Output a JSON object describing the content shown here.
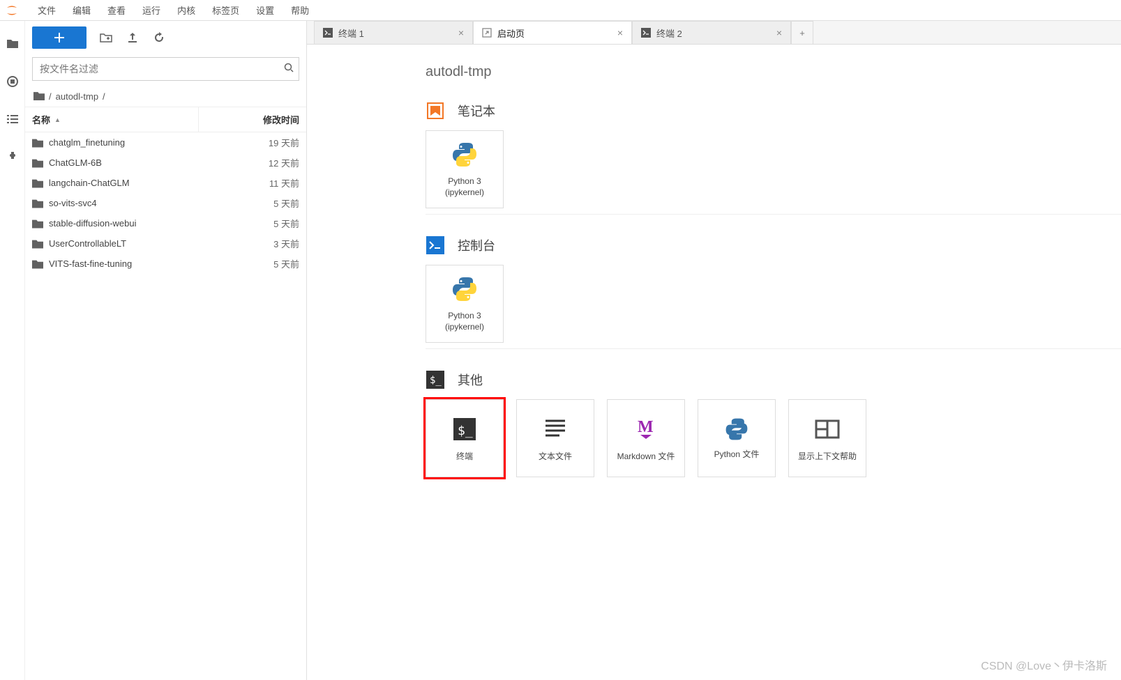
{
  "menu": {
    "items": [
      "文件",
      "编辑",
      "查看",
      "运行",
      "内核",
      "标签页",
      "设置",
      "帮助"
    ]
  },
  "sidebar": {
    "filter_placeholder": "按文件名过滤",
    "breadcrumb": {
      "root": "/",
      "folder": "autodl-tmp",
      "sep": "/"
    },
    "header": {
      "name": "名称",
      "modified": "修改时间",
      "sort_indicator": "▲"
    },
    "rows": [
      {
        "name": "chatglm_finetuning",
        "modified": "19 天前"
      },
      {
        "name": "ChatGLM-6B",
        "modified": "12 天前"
      },
      {
        "name": "langchain-ChatGLM",
        "modified": "11 天前"
      },
      {
        "name": "so-vits-svc4",
        "modified": "5 天前"
      },
      {
        "name": "stable-diffusion-webui",
        "modified": "5 天前"
      },
      {
        "name": "UserControllableLT",
        "modified": "3 天前"
      },
      {
        "name": "VITS-fast-fine-tuning",
        "modified": "5 天前"
      }
    ]
  },
  "tabs": [
    {
      "label": "终端 1",
      "icon": "terminal",
      "active": false
    },
    {
      "label": "启动页",
      "icon": "launch",
      "active": true
    },
    {
      "label": "终端 2",
      "icon": "terminal",
      "active": false
    }
  ],
  "launcher": {
    "title": "autodl-tmp",
    "sections": {
      "notebook": {
        "title": "笔记本",
        "card": {
          "line1": "Python 3",
          "line2": "(ipykernel)"
        }
      },
      "console": {
        "title": "控制台",
        "card": {
          "line1": "Python 3",
          "line2": "(ipykernel)"
        }
      },
      "other": {
        "title": "其他",
        "cards": [
          {
            "label": "终端",
            "type": "terminal",
            "highlight": true
          },
          {
            "label": "文本文件",
            "type": "text"
          },
          {
            "label": "Markdown 文件",
            "type": "markdown"
          },
          {
            "label": "Python 文件",
            "type": "python"
          },
          {
            "label": "显示上下文帮助",
            "type": "help"
          }
        ]
      }
    }
  },
  "watermark": "CSDN @Love丶伊卡洛斯"
}
